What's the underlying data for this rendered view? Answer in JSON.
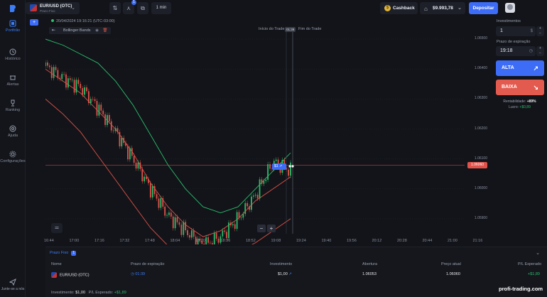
{
  "sidebar": {
    "items": [
      {
        "label": "Portfólio",
        "icon": "portfolio-icon",
        "badge": "1"
      },
      {
        "label": "Histórico",
        "icon": "history-icon"
      },
      {
        "label": "Alertas",
        "icon": "alarm-icon"
      },
      {
        "label": "Ranking",
        "icon": "trophy-icon"
      },
      {
        "label": "Ajuda",
        "icon": "help-icon"
      },
      {
        "label": "Configurações",
        "icon": "settings-icon"
      }
    ],
    "join_label": "Junte-se a nós"
  },
  "topbar": {
    "asset_name": "EUR/USD (OTC)",
    "asset_sub": "Prazo Fixo",
    "indicator_badge": "1",
    "timeframe": "1 min",
    "cashback": "Cashback",
    "balance": "$9.993,78",
    "deposit": "Depositar"
  },
  "chart_info": {
    "timestamp": "20/04/2024 19:16:21 (UTC-03:00)",
    "indicator": "Bollinger Bands",
    "trade_start": "Início do Trade",
    "trade_end": "Fim do Trade",
    "trade_time": "01:39",
    "entry_marker": "$1",
    "current_price": "1.06060"
  },
  "chart_data": {
    "type": "line",
    "x_ticks": [
      "16:44",
      "17:00",
      "17:16",
      "17:32",
      "17:48",
      "18:04",
      "18:20",
      "18:36",
      "18:52",
      "19:08",
      "19:24",
      "19:40",
      "19:56",
      "20:12",
      "20:28",
      "20:44",
      "21:00",
      "21:16"
    ],
    "y_ticks": [
      "1.06500",
      "1.06400",
      "1.06300",
      "1.06200",
      "1.06100",
      "1.06000",
      "1.05900"
    ],
    "ylim": [
      1.0585,
      1.0655
    ],
    "series": [
      {
        "kind": "upper_band",
        "color": "#2bbd6b",
        "values": [
          1.065,
          1.0648,
          1.0645,
          1.0642,
          1.0636,
          1.0628,
          1.0618,
          1.0608,
          1.06,
          1.0594,
          1.0592,
          1.0594,
          1.06,
          1.0606,
          1.0612
        ]
      },
      {
        "kind": "middle_band",
        "color": "#e0524a",
        "values": [
          1.064,
          1.0636,
          1.0632,
          1.0626,
          1.062,
          1.0612,
          1.0602,
          1.0594,
          1.0588,
          1.0584,
          1.0586,
          1.059,
          1.0596,
          1.06,
          1.0604
        ]
      },
      {
        "kind": "lower_band",
        "color": "#e0524a",
        "values": [
          1.063,
          1.0625,
          1.0619,
          1.0611,
          1.0603,
          1.0595,
          1.0587,
          1.0581,
          1.0577,
          1.0576,
          1.0577,
          1.0579,
          1.0582,
          1.0586,
          1.059
        ]
      },
      {
        "kind": "price",
        "color": "#2bbd6b",
        "values": [
          1.0641,
          1.0637,
          1.0634,
          1.0627,
          1.0619,
          1.061,
          1.06,
          1.0591,
          1.0586,
          1.0581,
          1.0584,
          1.059,
          1.0598,
          1.0609,
          1.0606
        ]
      }
    ]
  },
  "panel": {
    "investment_label": "Investimentos",
    "investment_value": "1",
    "expiry_label": "Prazo de expiração",
    "expiry_value": "19:18",
    "alta": "ALTA",
    "baixa": "BAIXA",
    "rent_label": "Rentabilidade:",
    "rent_value": "+89%",
    "profit_label": "Lucro:",
    "profit_value": "+$0,89"
  },
  "positions": {
    "title": "Prazo Fixo",
    "count": "1",
    "headers": [
      "Nome",
      "Prazo de expiração",
      "Investimento",
      "Abertura",
      "Preço atual",
      "P/L Esperado"
    ],
    "row": {
      "name": "EUR/USD (OTC)",
      "expiry": "01:39",
      "investment": "$1,00",
      "opening": "1.06053",
      "current": "1.06060",
      "pl": "+$1,89"
    },
    "footer_inv_label": "Investimento:",
    "footer_inv": "$1,00",
    "footer_pl_label": "P/L Esperado:",
    "footer_pl": "+$1,89"
  },
  "watermark": "profi-trading.com"
}
